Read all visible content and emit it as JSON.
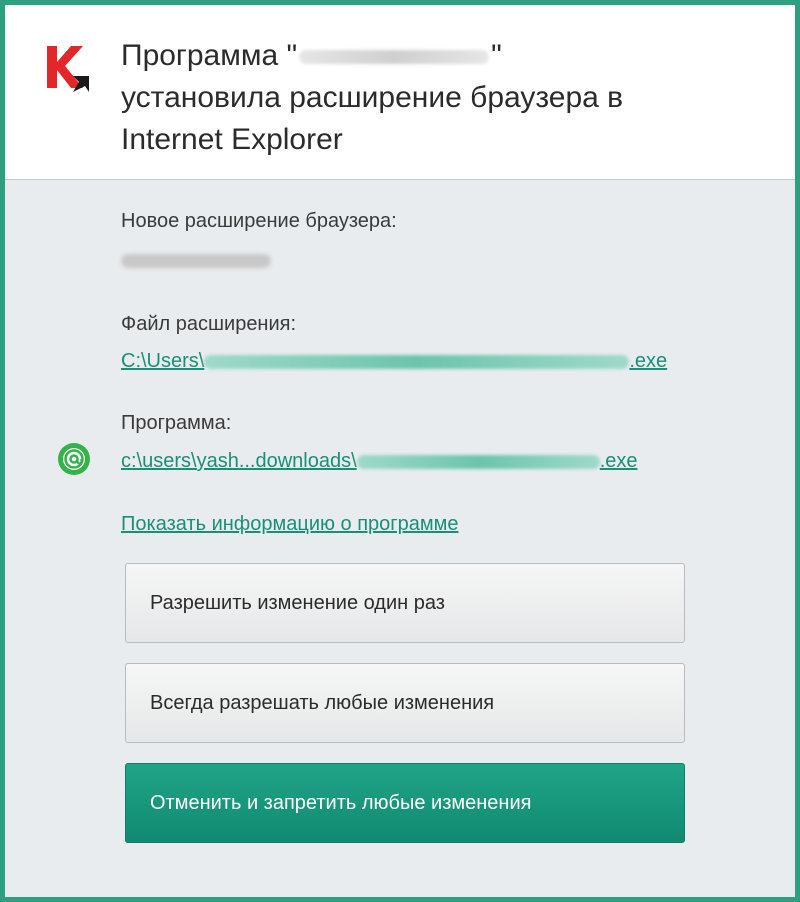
{
  "dialog": {
    "title_prefix": "Программа \"",
    "title_suffix": "\"",
    "title_line2": "установила расширение браузера в",
    "title_line3": "Internet Explorer"
  },
  "details": {
    "new_extension_label": "Новое расширение браузера:",
    "extension_file_label": "Файл расширения:",
    "extension_file_prefix": "C:\\Users\\",
    "extension_file_suffix": ".exe",
    "program_label": "Программа:",
    "program_path_prefix": "c:\\users\\yash...downloads\\",
    "program_path_suffix": ".exe",
    "show_info_link": "Показать информацию о программе"
  },
  "buttons": {
    "allow_once": "Разрешить изменение один раз",
    "allow_always": "Всегда разрешать любые изменения",
    "cancel_deny": "Отменить и запретить любые изменения"
  },
  "icons": {
    "app_logo": "kaspersky-k-logo",
    "program_icon": "green-at-sign-icon"
  },
  "colors": {
    "accent": "#17907a",
    "primary_button": "#159a7d",
    "border": "#2f9f82"
  }
}
